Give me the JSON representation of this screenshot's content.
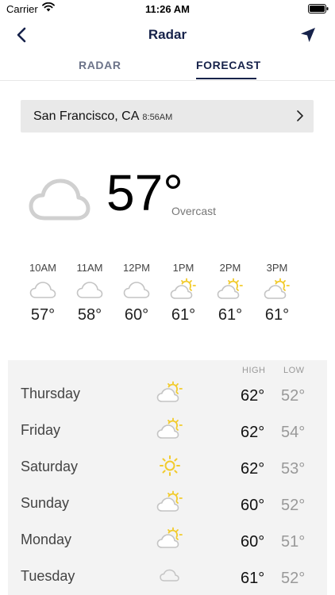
{
  "status": {
    "carrier": "Carrier",
    "time": "11:26 AM"
  },
  "nav": {
    "title": "Radar",
    "back_icon": "chevron-left-icon",
    "location_icon": "navigation-arrow-icon"
  },
  "tabs": [
    {
      "label": "RADAR",
      "active": false
    },
    {
      "label": "FORECAST",
      "active": true
    }
  ],
  "location": {
    "city": "San Francisco, CA",
    "time": "8:56AM"
  },
  "current": {
    "temp": "57°",
    "condition": "Overcast",
    "icon": "cloud-icon"
  },
  "hourly": [
    {
      "time": "10AM",
      "temp": "57°",
      "icon": "cloud"
    },
    {
      "time": "11AM",
      "temp": "58°",
      "icon": "cloud"
    },
    {
      "time": "12PM",
      "temp": "60°",
      "icon": "cloud"
    },
    {
      "time": "1PM",
      "temp": "61°",
      "icon": "partly-sunny"
    },
    {
      "time": "2PM",
      "temp": "61°",
      "icon": "partly-sunny"
    },
    {
      "time": "3PM",
      "temp": "61°",
      "icon": "partly-sunny"
    }
  ],
  "daily_header": {
    "high": "HIGH",
    "low": "LOW"
  },
  "daily": [
    {
      "day": "Thursday",
      "high": "62°",
      "low": "52°",
      "icon": "partly-sunny"
    },
    {
      "day": "Friday",
      "high": "62°",
      "low": "54°",
      "icon": "partly-sunny"
    },
    {
      "day": "Saturday",
      "high": "62°",
      "low": "53°",
      "icon": "sunny"
    },
    {
      "day": "Sunday",
      "high": "60°",
      "low": "52°",
      "icon": "partly-sunny"
    },
    {
      "day": "Monday",
      "high": "60°",
      "low": "51°",
      "icon": "partly-sunny"
    },
    {
      "day": "Tuesday",
      "high": "61°",
      "low": "52°",
      "icon": "cloud"
    }
  ],
  "colors": {
    "navy": "#16224a",
    "sun": "#f2cb2c",
    "cloud_stroke": "#c8c8c8"
  }
}
